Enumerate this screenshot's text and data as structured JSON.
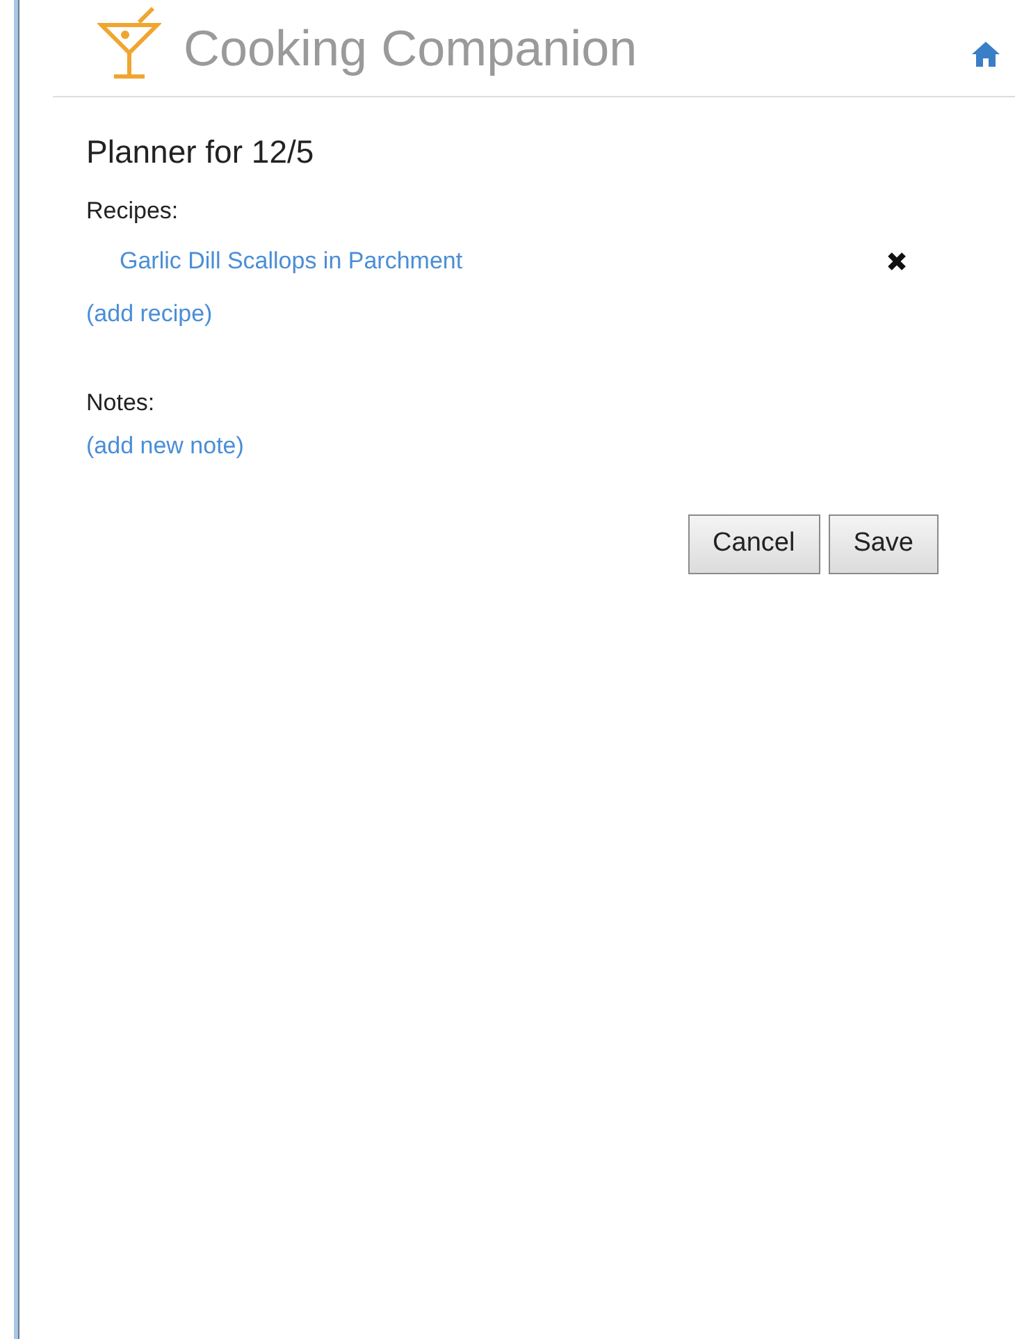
{
  "header": {
    "title": "Cooking Companion"
  },
  "planner": {
    "title": "Planner for 12/5",
    "recipes_label": "Recipes:",
    "recipes": [
      {
        "name": "Garlic Dill Scallops in Parchment"
      }
    ],
    "add_recipe": "(add recipe)",
    "notes_label": "Notes:",
    "add_note": "(add new note)"
  },
  "buttons": [
    "Cancel",
    "Save"
  ]
}
